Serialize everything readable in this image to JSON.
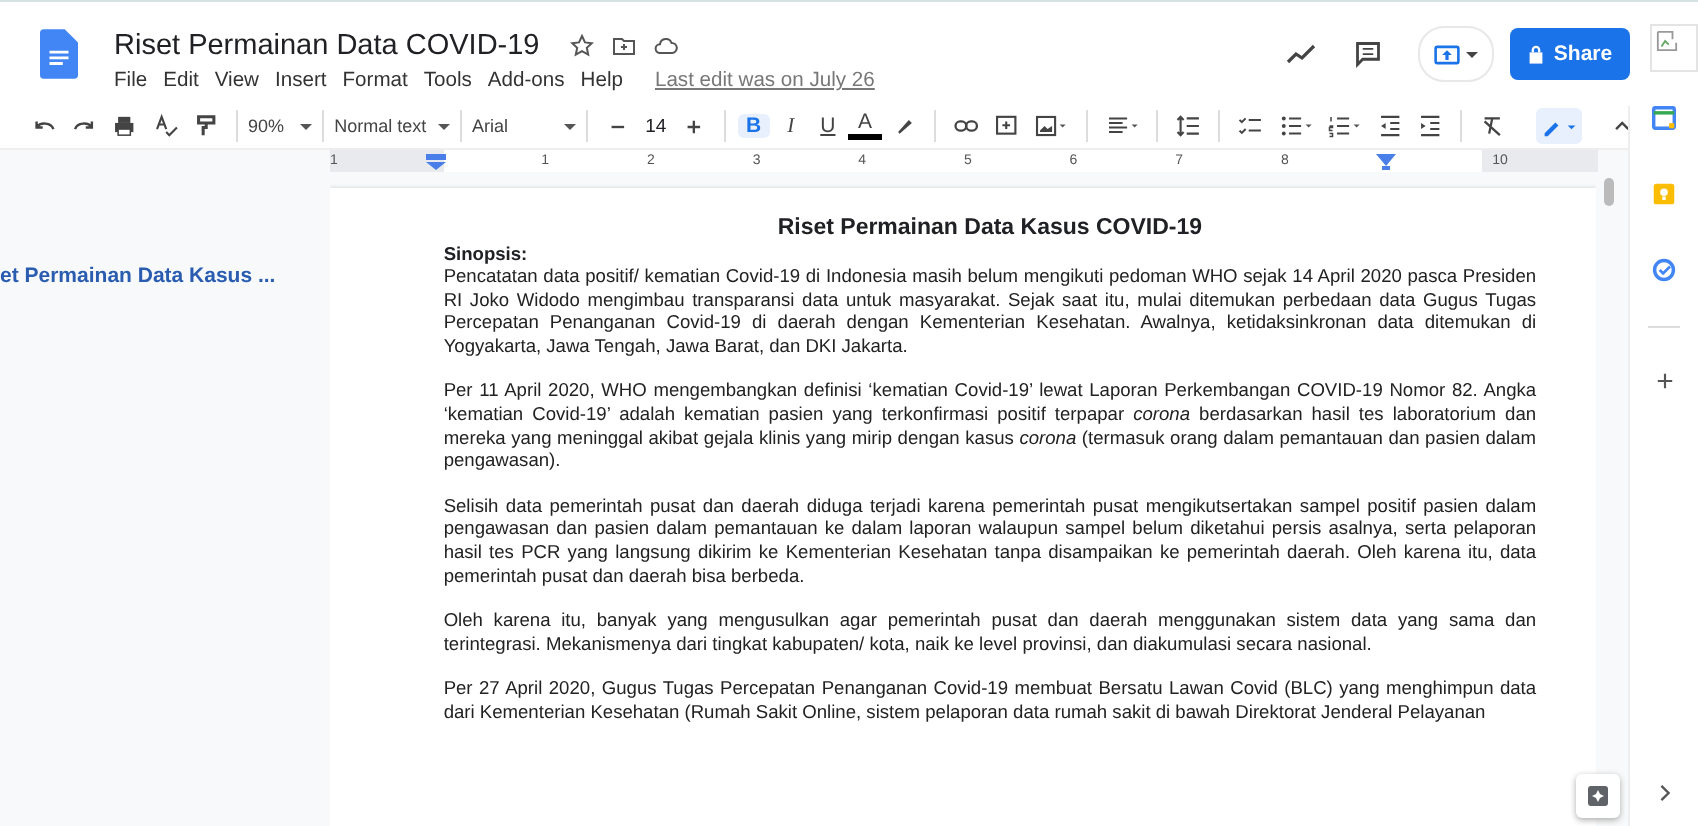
{
  "document": {
    "title": "Riset Permainan Data COVID-19",
    "menu": [
      "File",
      "Edit",
      "View",
      "Insert",
      "Format",
      "Tools",
      "Add-ons",
      "Help"
    ],
    "last_edit": "Last edit was on July 26"
  },
  "share_button": "Share",
  "toolbar": {
    "zoom": "90%",
    "style": "Normal text",
    "font": "Arial",
    "font_size": "14",
    "bold": "B",
    "bold_on": true,
    "italic": "I",
    "underline": "U",
    "text_color": "A"
  },
  "ruler": [
    "1",
    "1",
    "2",
    "3",
    "4",
    "5",
    "6",
    "7",
    "8",
    "10"
  ],
  "outline": [
    {
      "text": "et Permainan Data Kasus ...",
      "selected": true
    }
  ],
  "page": {
    "heading": "Riset Permainan Data Kasus COVID-19",
    "subheading": "Sinopsis:",
    "paragraphs": [
      "Pencatatan data positif/ kematian Covid-19 di Indonesia masih belum mengikuti pedoman WHO sejak 14 April 2020 pasca Presiden RI Joko Widodo mengimbau transparansi data untuk masyarakat. Sejak saat itu, mulai ditemukan perbedaan data Gugus Tugas Percepatan Penanganan Covid-19 di daerah dengan Kementerian Kesehatan. Awalnya, ketidaksinkronan data ditemukan di Yogyakarta, Jawa Tengah, Jawa Barat, dan DKI Jakarta.",
      "Per 11 April 2020, WHO mengembangkan definisi ‘kematian Covid-19’ lewat Laporan Perkembangan COVID-19 Nomor 82.  Angka ‘kematian Covid-19’ adalah kematian pasien yang terkonfirmasi positif terpapar *corona* berdasarkan hasil tes laboratorium dan mereka yang meninggal akibat gejala klinis yang mirip dengan kasus *corona* (termasuk orang dalam pemantauan dan pasien dalam pengawasan).",
      "Selisih data pemerintah pusat dan daerah diduga terjadi karena pemerintah pusat mengikutsertakan sampel positif pasien dalam pengawasan dan pasien dalam pemantauan ke dalam laporan walaupun sampel belum diketahui persis asalnya, serta pelaporan hasil tes PCR yang langsung dikirim ke Kementerian Kesehatan tanpa disampaikan ke pemerintah daerah. Oleh karena itu, data pemerintah pusat dan daerah bisa berbeda.",
      "Oleh karena itu, banyak yang mengusulkan agar pemerintah pusat dan daerah menggunakan sistem data yang sama dan terintegrasi. Mekanismenya dari tingkat kabupaten/ kota, naik ke level provinsi, dan diakumulasi secara nasional.",
      "Per 27 April 2020, Gugus Tugas Percepatan Penanganan Covid-19 membuat Bersatu Lawan Covid (BLC) yang menghimpun data dari Kementerian Kesehatan (Rumah Sakit Online, sistem pelaporan data rumah sakit di bawah Direktorat Jenderal Pelayanan"
    ]
  }
}
